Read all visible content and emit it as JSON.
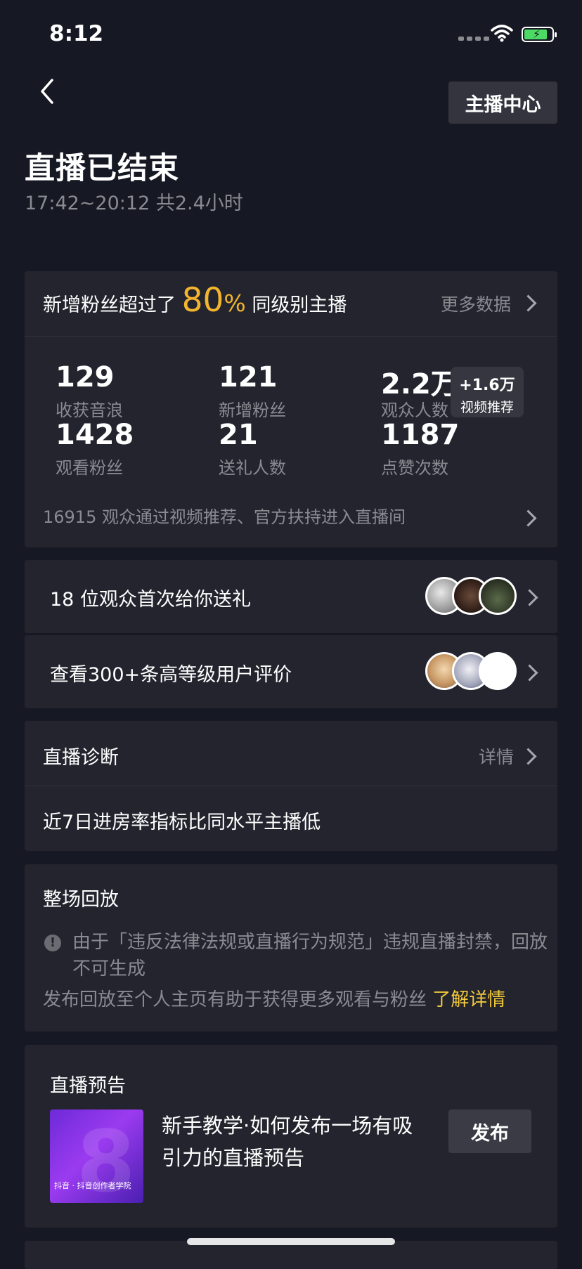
{
  "status_bar": {
    "time": "8:12"
  },
  "header": {
    "center_button": "主播中心",
    "title": "直播已结束",
    "subtitle": "17:42~20:12 共2.4小时"
  },
  "summary": {
    "prefix": "新增粉丝超过了",
    "percent": "80",
    "percent_sign": "%",
    "suffix": "同级别主播",
    "more": "更多数据",
    "stats": [
      {
        "value": "129",
        "label": "收获音浪"
      },
      {
        "value": "121",
        "label": "新增粉丝"
      },
      {
        "value": "2.2万",
        "label": "观众人数"
      },
      {
        "value": "1428",
        "label": "观看粉丝"
      },
      {
        "value": "21",
        "label": "送礼人数"
      },
      {
        "value": "1187",
        "label": "点赞次数"
      }
    ],
    "badge": {
      "value": "+1.6万",
      "label": "视频推荐"
    },
    "note": "16915 观众通过视频推荐、官方扶持进入直播间"
  },
  "gift_row": {
    "label": "18 位观众首次给你送礼"
  },
  "review_row": {
    "label": "查看300+条高等级用户评价"
  },
  "diagnosis": {
    "title": "直播诊断",
    "detail": "详情",
    "body": "近7日进房率指标比同水平主播低"
  },
  "replay": {
    "title": "整场回放",
    "warning": "由于「违反法律法规或直播行为规范」违规直播封禁，回放不可生成",
    "tip": "发布回放至个人主页有助于获得更多观看与粉丝",
    "link": "了解详情"
  },
  "preview": {
    "title": "直播预告",
    "thumb_caption": "抖音 · 抖音创作者学院",
    "description": "新手教学·如何发布一场有吸引力的直播预告",
    "button": "发布"
  },
  "colors": {
    "background": "#161823",
    "card": "#23242e",
    "accent": "#f3b52e",
    "link": "#f3c93b"
  }
}
